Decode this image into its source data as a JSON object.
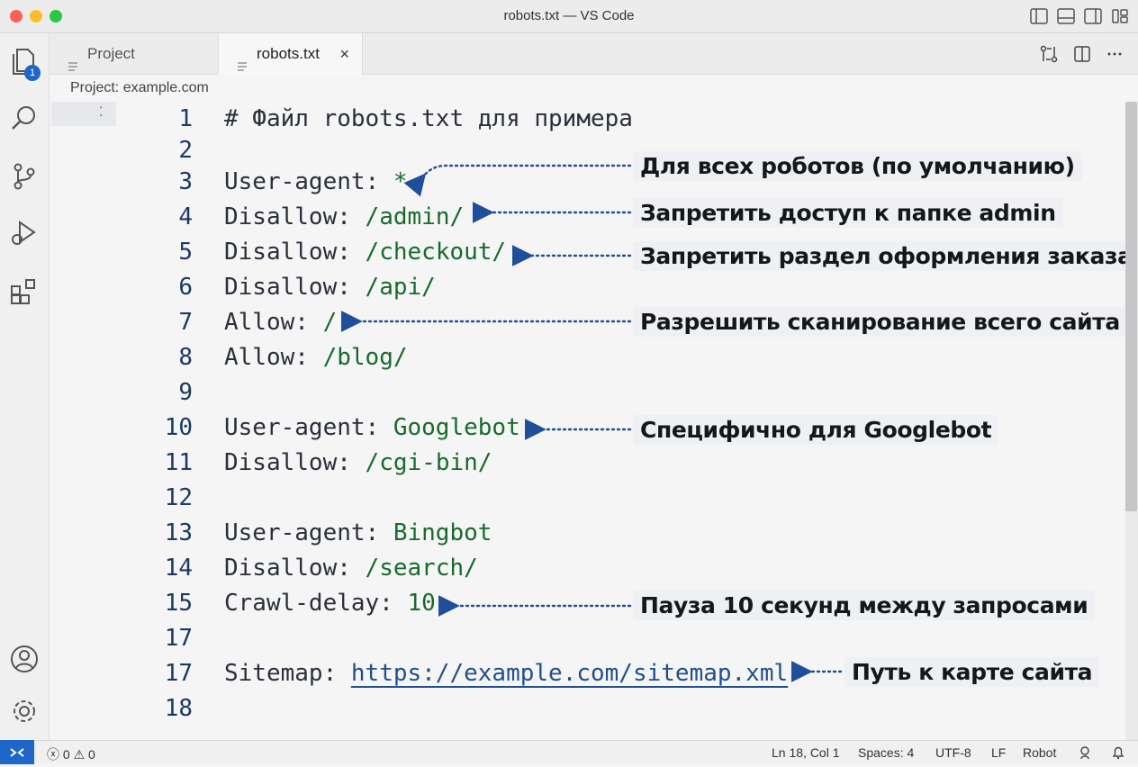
{
  "window": {
    "title": "robots.txt — VS Code"
  },
  "activity": {
    "badge_count": "1"
  },
  "tabs": [
    {
      "label": "Project",
      "active": false
    },
    {
      "label": "robots.txt",
      "active": true,
      "close": "×"
    }
  ],
  "breadcrumb": "Project: example.com",
  "editor": {
    "lines": [
      {
        "num": "1",
        "text": "# Файл robots.txt для примера"
      },
      {
        "num": "2",
        "text": ""
      },
      {
        "num": "3",
        "key": "User-agent: ",
        "value": "*"
      },
      {
        "num": "4",
        "key": "Disallow: ",
        "value": "/admin/"
      },
      {
        "num": "5",
        "key": "Disallow: ",
        "value": "/checkout/"
      },
      {
        "num": "6",
        "key": "Disallow: ",
        "value": "/api/"
      },
      {
        "num": "7",
        "key": "Allow: ",
        "value": "/"
      },
      {
        "num": "8",
        "key": "Allow: ",
        "value": "/blog/"
      },
      {
        "num": "9",
        "text": ""
      },
      {
        "num": "10",
        "key": "User-agent: ",
        "value": "Googlebot"
      },
      {
        "num": "11",
        "key": "Disallow: ",
        "value": "/cgi-bin/"
      },
      {
        "num": "12",
        "text": ""
      },
      {
        "num": "13",
        "key": "User-agent: ",
        "value": "Bingbot"
      },
      {
        "num": "14",
        "key": "Disallow: ",
        "value": "/search/"
      },
      {
        "num": "15",
        "key": "Crawl-delay: ",
        "value": "10"
      },
      {
        "num": "17",
        "text": ""
      },
      {
        "num": "17",
        "key": "Sitemap: ",
        "value": "https://example.com/sitemap.xml"
      },
      {
        "num": "18",
        "text": ""
      }
    ],
    "annotations": [
      "Для всех роботов (по умолчанию)",
      "Запретить доступ к папке admin",
      "Запретить раздел оформления заказа",
      "Разрешить сканирование всего сайта",
      "Специфично для Googlebot",
      "Пауза 10 секунд между запросами",
      "Путь к карте сайта"
    ]
  },
  "status": {
    "errors": "0",
    "warnings": "0",
    "position": "Ln 18, Col 1",
    "spaces": "Spaces: 4",
    "encoding": "UTF-8",
    "eol": "LF",
    "language": "Robot"
  },
  "colors": {
    "accent": "#1f66c9",
    "value": "#176b2c",
    "arrow": "#1f4f9a"
  }
}
